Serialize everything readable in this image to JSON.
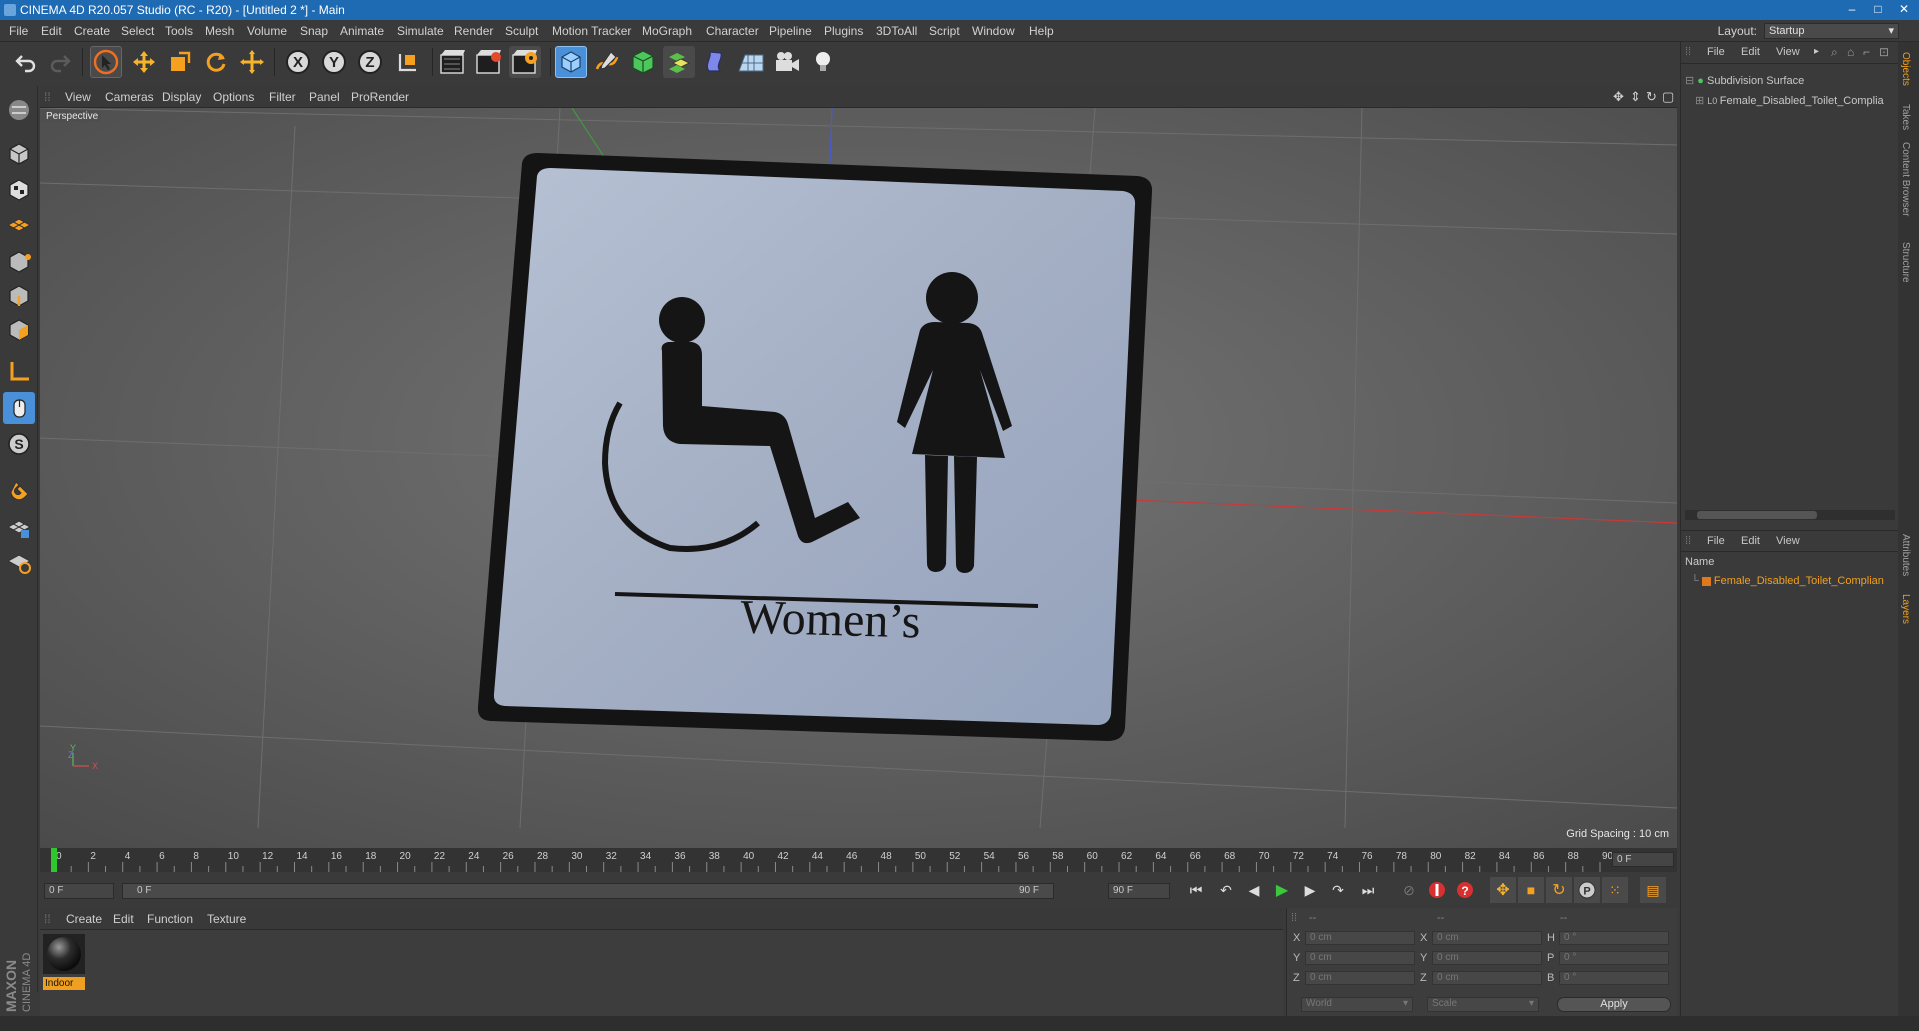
{
  "window": {
    "title": "CINEMA 4D R20.057 Studio (RC - R20) - [Untitled 2 *] - Main",
    "min": "–",
    "max": "□",
    "close": "✕"
  },
  "menubar": {
    "items": [
      "File",
      "Edit",
      "Create",
      "Select",
      "Tools",
      "Mesh",
      "Volume",
      "Snap",
      "Animate",
      "Simulate",
      "Render",
      "Sculpt",
      "Motion Tracker",
      "MoGraph",
      "Character",
      "Pipeline",
      "Plugins",
      "3DToAll",
      "Script",
      "Window",
      "Help"
    ],
    "layout_label": "Layout:",
    "layout_value": "Startup"
  },
  "toolbar": {
    "icons": [
      "undo-icon",
      "redo-icon",
      "select-arrow-icon",
      "move-icon",
      "scale-icon",
      "rotate-icon",
      "transform-icon",
      "x-axis-icon",
      "y-axis-icon",
      "z-axis-icon",
      "coordinate-system-icon",
      "render-view-icon",
      "render-picture-viewer-icon",
      "render-settings-icon",
      "cube-icon",
      "pen-spline-icon",
      "subdivision-icon",
      "array-icon",
      "deformer-icon",
      "floor-icon",
      "camera-icon",
      "light-icon"
    ],
    "axis_x": "X",
    "axis_y": "Y",
    "axis_z": "Z"
  },
  "viewport": {
    "menu": [
      "View",
      "Cameras",
      "Display",
      "Options",
      "Filter",
      "Panel",
      "ProRender"
    ],
    "camera_label": "Perspective",
    "grid_spacing": "Grid Spacing : 10 cm",
    "sign_text": "Women’s",
    "axis_labels": {
      "y": "Y",
      "z": "Z",
      "x": "X"
    }
  },
  "timeline": {
    "ticks": [
      0,
      2,
      4,
      6,
      8,
      10,
      12,
      14,
      16,
      18,
      20,
      22,
      24,
      26,
      28,
      30,
      32,
      34,
      36,
      38,
      40,
      42,
      44,
      46,
      48,
      50,
      52,
      54,
      56,
      58,
      60,
      62,
      64,
      66,
      68,
      70,
      72,
      74,
      76,
      78,
      80,
      82,
      84,
      86,
      88,
      90
    ],
    "current_frame_field": "0 F",
    "start_field": "0 F",
    "range_start": "0 F",
    "range_end": "90 F",
    "end_field": "90 F"
  },
  "material_manager": {
    "menu": [
      "Create",
      "Edit",
      "Function",
      "Texture"
    ],
    "material_name": "Indoor"
  },
  "coordinates": {
    "headers": [
      "--",
      "--",
      "--"
    ],
    "rows": [
      {
        "l1": "X",
        "v1": "0 cm",
        "l2": "X",
        "v2": "0 cm",
        "l3": "H",
        "v3": "0 °"
      },
      {
        "l1": "Y",
        "v1": "0 cm",
        "l2": "Y",
        "v2": "0 cm",
        "l3": "P",
        "v3": "0 °"
      },
      {
        "l1": "Z",
        "v1": "0 cm",
        "l2": "Z",
        "v2": "0 cm",
        "l3": "B",
        "v3": "0 °"
      }
    ],
    "space": "World",
    "mode": "Scale",
    "apply": "Apply"
  },
  "object_manager": {
    "menu": [
      "File",
      "Edit",
      "View"
    ],
    "objects": [
      "Subdivision Surface",
      "Female_Disabled_Toilet_Complia"
    ]
  },
  "layer_manager": {
    "menu": [
      "File",
      "Edit",
      "View"
    ],
    "column_name": "Name",
    "layer": "Female_Disabled_Toilet_Complian"
  },
  "side_tabs": [
    "Objects",
    "Takes",
    "Content Browser",
    "Structure",
    "Attributes",
    "Layers"
  ],
  "logo": {
    "line1": "MAXON",
    "line2": "CINEMA 4D"
  },
  "colors": {
    "accent": "#f0a020",
    "title_bar": "#1e6ab3",
    "active_tool": "#4a90d9"
  }
}
